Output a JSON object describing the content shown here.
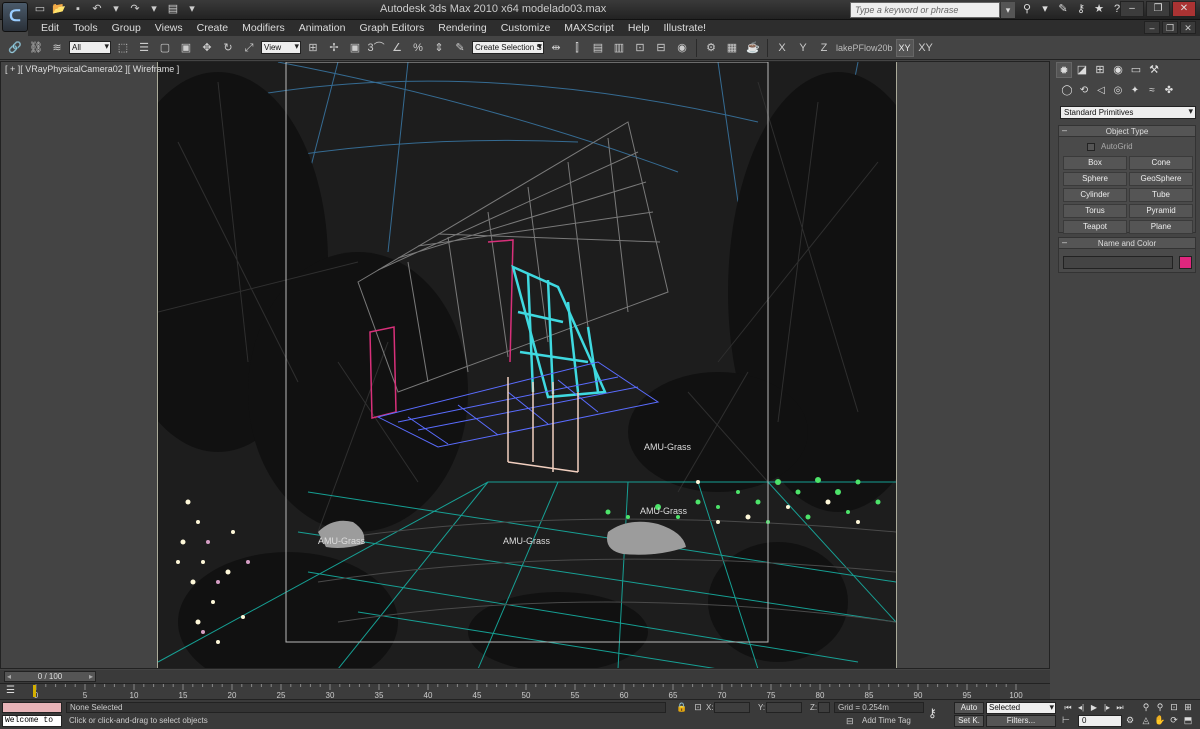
{
  "window": {
    "title": "Autodesk 3ds Max  2010 x64        modelado03.max",
    "logo": "3ds-max-logo",
    "search_placeholder": "Type a keyword or phrase"
  },
  "menu": [
    "Edit",
    "Tools",
    "Group",
    "Views",
    "Create",
    "Modifiers",
    "Animation",
    "Graph Editors",
    "Rendering",
    "Customize",
    "MAXScript",
    "Help",
    "Illustrate!"
  ],
  "toolbar": {
    "selection_filter": "All",
    "reference_coord": "View",
    "snap_label": "3",
    "named_selection": "Create Selection S",
    "axis_x": "X",
    "axis_y": "Y",
    "axis_z": "Z",
    "layer_name": "lakePFlow20b",
    "constraint_xy": "XY",
    "constraint_xy2": "XY"
  },
  "viewport": {
    "label": "[ + ][ VRayPhysicalCamera02 ][ Wireframe ]",
    "object_labels": [
      "AMU-Grass",
      "AMU-Grass",
      "AMU-Grass",
      "AMU-Grass"
    ],
    "active_border_color": "#aaa98a",
    "accent_colors": {
      "cyan": "#3fd9e0",
      "magenta": "#d8307a",
      "blue": "#5a6cff",
      "green": "#4de36a"
    }
  },
  "command_panel": {
    "category": "Standard Primitives",
    "object_type": {
      "title": "Object Type",
      "autogrid": "AutoGrid",
      "buttons": [
        "Box",
        "Cone",
        "Sphere",
        "GeoSphere",
        "Cylinder",
        "Tube",
        "Torus",
        "Pyramid",
        "Teapot",
        "Plane"
      ]
    },
    "name_color": {
      "title": "Name and Color",
      "swatch_color": "#e0267e"
    }
  },
  "timeline": {
    "frame_display": "0 / 100",
    "ticks": [
      0,
      5,
      10,
      15,
      20,
      25,
      30,
      35,
      40,
      45,
      50,
      55,
      60,
      65,
      70,
      75,
      80,
      85,
      90,
      95,
      100
    ]
  },
  "status": {
    "listener": "Welcome to",
    "selection": "None Selected",
    "prompt": "Click or click-and-drag to select objects",
    "x_label": "X:",
    "y_label": "Y:",
    "z_label": "Z:",
    "grid": "Grid = 0.254m",
    "add_time_tag": "Add Time Tag",
    "auto_key": "Auto",
    "set_key": "Set K.",
    "key_filter_mode": "Selected",
    "filters": "Filters...",
    "current_frame": "0"
  }
}
